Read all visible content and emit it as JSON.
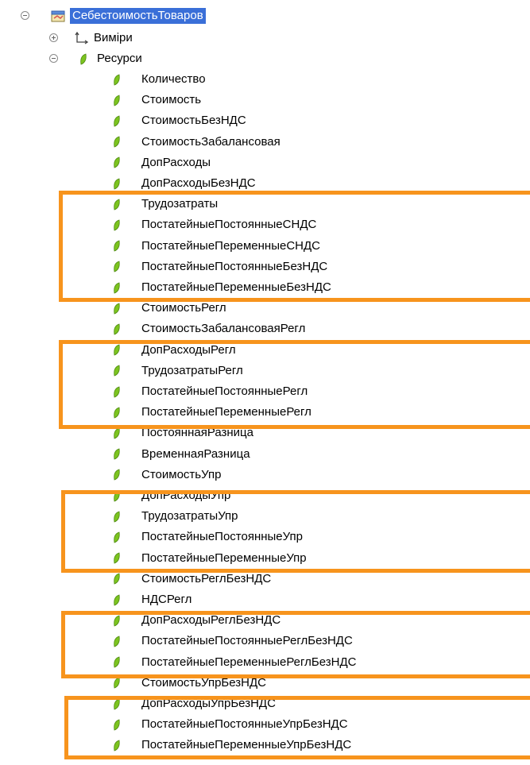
{
  "tree": {
    "root": {
      "label": "СебестоимостьТоваров",
      "expanded": true
    },
    "dimensions": {
      "label": "Виміри",
      "expanded": false
    },
    "resources": {
      "label": "Ресурси",
      "expanded": true,
      "items": [
        "Количество",
        "Стоимость",
        "СтоимостьБезНДС",
        "СтоимостьЗабалансовая",
        "ДопРасходы",
        "ДопРасходыБезНДС",
        "Трудозатраты",
        "ПостатейныеПостоянныеСНДС",
        "ПостатейныеПеременныеСНДС",
        "ПостатейныеПостоянныеБезНДС",
        "ПостатейныеПеременныеБезНДС",
        "СтоимостьРегл",
        "СтоимостьЗабалансоваяРегл",
        "ДопРасходыРегл",
        "ТрудозатратыРегл",
        "ПостатейныеПостоянныеРегл",
        "ПостатейныеПеременныеРегл",
        "ПостояннаяРазница",
        "ВременнаяРазница",
        "СтоимостьУпр",
        "ДопРасходыУпр",
        "ТрудозатратыУпр",
        "ПостатейныеПостоянныеУпр",
        "ПостатейныеПеременныеУпр",
        "СтоимостьРеглБезНДС",
        "НДСРегл",
        "ДопРасходыРеглБезНДС",
        "ПостатейныеПостоянныеРеглБезНДС",
        "ПостатейныеПеременныеРеглБезНДС",
        "СтоимостьУпрБезНДС",
        "ДопРасходыУпрБезНДС",
        "ПостатейныеПостоянныеУпрБезНДС",
        "ПостатейныеПеременныеУпрБезНДС"
      ]
    }
  },
  "colors": {
    "highlight": "#f7941d",
    "selection": "#3a6fd8",
    "leaf": "#7cc41f"
  },
  "icons": {
    "root": "register-cube-icon",
    "dimensions": "dimensions-axis-icon",
    "resource": "leaf-icon"
  }
}
